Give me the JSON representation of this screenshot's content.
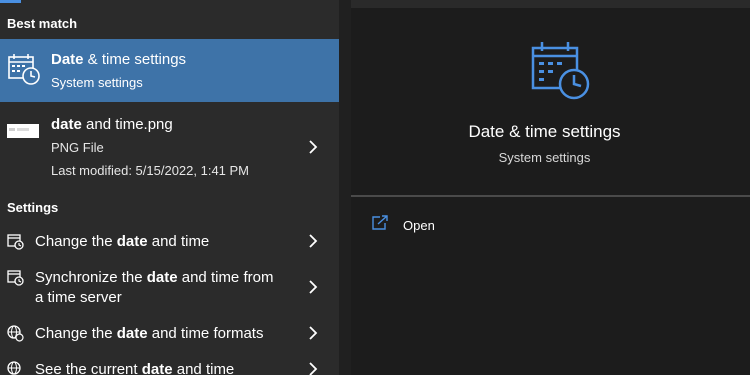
{
  "left_panel": {
    "best_match_header": "Best match",
    "best_match": {
      "title_bold": "Date",
      "title_rest": " & time settings",
      "subtitle": "System settings",
      "icon": "calendar-clock-icon"
    },
    "file_result": {
      "title_bold": "date",
      "title_rest": " and time.png",
      "type": "PNG File",
      "last_modified": "Last modified: 5/15/2022, 1:41 PM"
    },
    "settings_header": "Settings",
    "settings_items": [
      {
        "pre": "Change the ",
        "bold": "date",
        "post": " and time",
        "line2": ""
      },
      {
        "pre": "Synchronize the ",
        "bold": "date",
        "post": " and time from",
        "line2": "a time server"
      },
      {
        "pre": "Change the ",
        "bold": "date",
        "post": " and time formats",
        "line2": ""
      },
      {
        "pre": "See the current ",
        "bold": "date",
        "post": " and time",
        "line2": ""
      }
    ]
  },
  "right_panel": {
    "title": "Date & time settings",
    "subtitle": "System settings",
    "actions": [
      {
        "label": "Open",
        "icon": "open-external-icon"
      }
    ]
  },
  "colors": {
    "accent": "#4a90e2",
    "selection": "#3e73a8",
    "left_bg": "#2b2b2b",
    "right_bg": "#1c1c1c"
  }
}
